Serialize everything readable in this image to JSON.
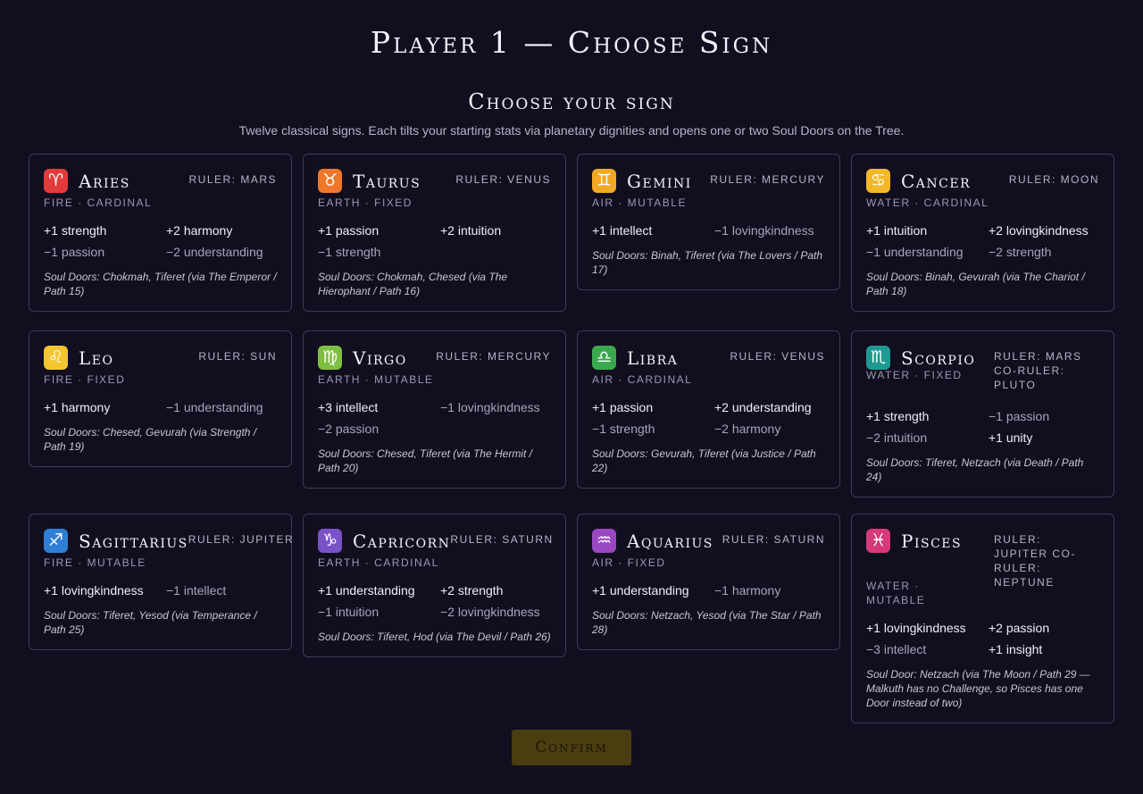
{
  "header": {
    "title": "Player 1 — Choose Sign",
    "section_title": "Choose your sign",
    "subtitle": "Twelve classical signs. Each tilts your starting stats via planetary dignities and opens one or two Soul Doors on the Tree."
  },
  "signs": [
    {
      "name": "Aries",
      "symbol": "♈",
      "icon": "aries-icon",
      "color": "#e23b3b",
      "ruler": "Ruler: Mars",
      "element": "Fire · Cardinal",
      "stats": [
        {
          "text": "+1 strength",
          "pos": true
        },
        {
          "text": "+2 harmony",
          "pos": true
        },
        {
          "text": "−1 passion",
          "pos": false
        },
        {
          "text": "−2 understanding",
          "pos": false
        }
      ],
      "doors": "Soul Doors: Chokmah, Tiferet (via The Emperor / Path 15)"
    },
    {
      "name": "Taurus",
      "symbol": "♉",
      "icon": "taurus-icon",
      "color": "#f0762a",
      "ruler": "Ruler: Venus",
      "element": "Earth · Fixed",
      "stats": [
        {
          "text": "+1 passion",
          "pos": true
        },
        {
          "text": "+2 intuition",
          "pos": true
        },
        {
          "text": "−1 strength",
          "pos": false
        }
      ],
      "doors": "Soul Doors: Chokmah, Chesed (via The Hierophant / Path 16)"
    },
    {
      "name": "Gemini",
      "symbol": "♊",
      "icon": "gemini-icon",
      "color": "#f2a825",
      "ruler": "Ruler: Mercury",
      "element": "Air · Mutable",
      "stats": [
        {
          "text": "+1 intellect",
          "pos": true
        },
        {
          "text": "−1 lovingkindness",
          "pos": false
        }
      ],
      "doors": "Soul Doors: Binah, Tiferet (via The Lovers / Path 17)"
    },
    {
      "name": "Cancer",
      "symbol": "♋",
      "icon": "cancer-icon",
      "color": "#f2b82a",
      "ruler": "Ruler: Moon",
      "element": "Water · Cardinal",
      "stats": [
        {
          "text": "+1 intuition",
          "pos": true
        },
        {
          "text": "+2 lovingkindness",
          "pos": true
        },
        {
          "text": "−1 understanding",
          "pos": false
        },
        {
          "text": "−2 strength",
          "pos": false
        }
      ],
      "doors": "Soul Doors: Binah, Gevurah (via The Chariot / Path 18)"
    },
    {
      "name": "Leo",
      "symbol": "♌",
      "icon": "leo-icon",
      "color": "#f2c62c",
      "ruler": "Ruler: Sun",
      "element": "Fire · Fixed",
      "stats": [
        {
          "text": "+1 harmony",
          "pos": true
        },
        {
          "text": "−1 understanding",
          "pos": false
        }
      ],
      "doors": "Soul Doors: Chesed, Gevurah (via Strength / Path 19)"
    },
    {
      "name": "Virgo",
      "symbol": "♍",
      "icon": "virgo-icon",
      "color": "#7fbf3f",
      "ruler": "Ruler: Mercury",
      "element": "Earth · Mutable",
      "stats": [
        {
          "text": "+3 intellect",
          "pos": true
        },
        {
          "text": "−1 lovingkindness",
          "pos": false
        },
        {
          "text": "−2 passion",
          "pos": false
        }
      ],
      "doors": "Soul Doors: Chesed, Tiferet (via The Hermit / Path 20)"
    },
    {
      "name": "Libra",
      "symbol": "♎",
      "icon": "libra-icon",
      "color": "#3aa84e",
      "ruler": "Ruler: Venus",
      "element": "Air · Cardinal",
      "stats": [
        {
          "text": "+1 passion",
          "pos": true
        },
        {
          "text": "+2 understanding",
          "pos": true
        },
        {
          "text": "−1 strength",
          "pos": false
        },
        {
          "text": "−2 harmony",
          "pos": false
        }
      ],
      "doors": "Soul Doors: Gevurah, Tiferet (via Justice / Path 22)"
    },
    {
      "name": "Scorpio",
      "symbol": "♏",
      "icon": "scorpio-icon",
      "color": "#1f9a93",
      "ruler": "Ruler: Mars co-ruler: Pluto",
      "element": "Water · Fixed",
      "stats": [
        {
          "text": "+1 strength",
          "pos": true
        },
        {
          "text": "−1 passion",
          "pos": false
        },
        {
          "text": "−2 intuition",
          "pos": false
        },
        {
          "text": "+1 unity",
          "pos": true
        }
      ],
      "doors": "Soul Doors: Tiferet, Netzach (via Death / Path 24)"
    },
    {
      "name": "Sagittarius",
      "symbol": "♐",
      "icon": "sagittarius-icon",
      "color": "#2f7fd6",
      "ruler": "Ruler: Jupiter",
      "element": "Fire · Mutable",
      "stats": [
        {
          "text": "+1 lovingkindness",
          "pos": true
        },
        {
          "text": "−1 intellect",
          "pos": false
        }
      ],
      "doors": "Soul Doors: Tiferet, Yesod (via Temperance / Path 25)"
    },
    {
      "name": "Capricorn",
      "symbol": "♑",
      "icon": "capricorn-icon",
      "color": "#7a52c8",
      "ruler": "Ruler: Saturn",
      "element": "Earth · Cardinal",
      "stats": [
        {
          "text": "+1 understanding",
          "pos": true
        },
        {
          "text": "+2 strength",
          "pos": true
        },
        {
          "text": "−1 intuition",
          "pos": false
        },
        {
          "text": "−2 lovingkindness",
          "pos": false
        }
      ],
      "doors": "Soul Doors: Tiferet, Hod (via The Devil / Path 26)"
    },
    {
      "name": "Aquarius",
      "symbol": "♒",
      "icon": "aquarius-icon",
      "color": "#9a48c2",
      "ruler": "Ruler: Saturn",
      "element": "Air · Fixed",
      "stats": [
        {
          "text": "+1 understanding",
          "pos": true
        },
        {
          "text": "−1 harmony",
          "pos": false
        }
      ],
      "doors": "Soul Doors: Netzach, Yesod (via The Star / Path 28)"
    },
    {
      "name": "Pisces",
      "symbol": "♓",
      "icon": "pisces-icon",
      "color": "#d63a78",
      "ruler": "Ruler: Jupiter co-ruler: Neptune",
      "element": "Water · Mutable",
      "stats": [
        {
          "text": "+1 lovingkindness",
          "pos": true
        },
        {
          "text": "+2 passion",
          "pos": true
        },
        {
          "text": "−3 intellect",
          "pos": false
        },
        {
          "text": "+1 insight",
          "pos": true
        }
      ],
      "doors": "Soul Door: Netzach (via The Moon / Path 29 — Malkuth has no Challenge, so Pisces has one Door instead of two)"
    }
  ],
  "confirm_label": "Confirm"
}
